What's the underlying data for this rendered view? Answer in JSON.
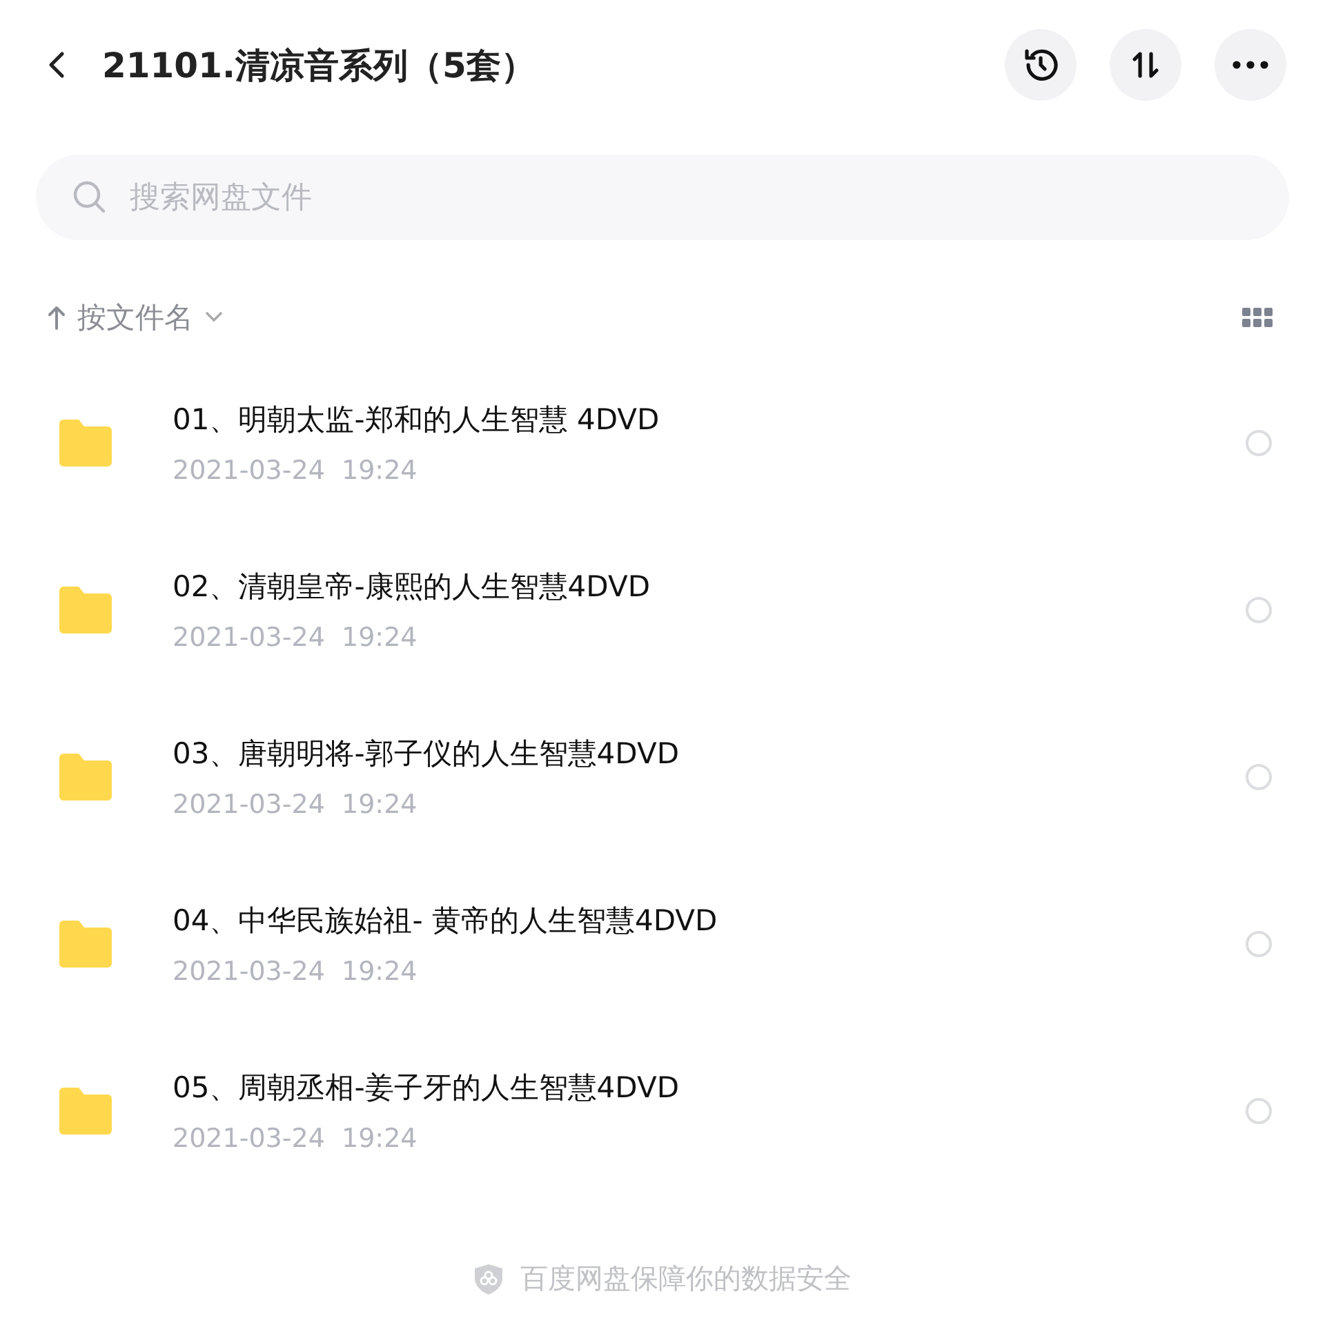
{
  "header": {
    "title": "21101.清凉音系列（5套）"
  },
  "search": {
    "placeholder": "搜索网盘文件"
  },
  "sort": {
    "label": "按文件名"
  },
  "files": [
    {
      "name": "01、明朝太监-郑和的人生智慧 4DVD",
      "date": "2021-03-24  19:24",
      "selected": false
    },
    {
      "name": "02、清朝皇帝-康熙的人生智慧4DVD",
      "date": "2021-03-24  19:24",
      "selected": false
    },
    {
      "name": "03、唐朝明将-郭子仪的人生智慧4DVD",
      "date": "2021-03-24  19:24",
      "selected": false
    },
    {
      "name": "04、中华民族始祖- 黄帝的人生智慧4DVD",
      "date": "2021-03-24  19:24",
      "selected": false
    },
    {
      "name": "05、周朝丞相-姜子牙的人生智慧4DVD",
      "date": "2021-03-24  19:24",
      "selected": false
    }
  ],
  "footer": {
    "text": "百度网盘保障你的数据安全"
  }
}
